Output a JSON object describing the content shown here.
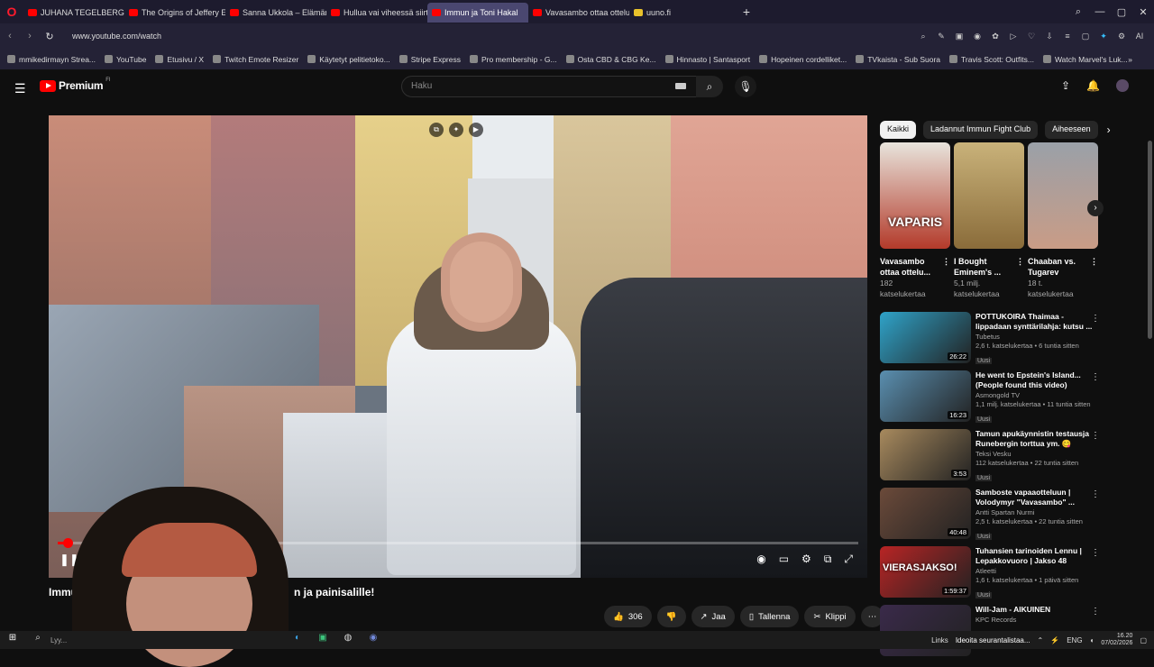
{
  "browser": {
    "tabs": [
      {
        "label": "JUHANA TEGELBERG AAS",
        "fav": "youtube"
      },
      {
        "label": "The Origins of Jeffery Epst",
        "fav": "youtube"
      },
      {
        "label": "Sanna Ukkola – Elämäntap",
        "fav": "youtube"
      },
      {
        "label": "Hullua vai viheessä siirtym",
        "fav": "youtube"
      },
      {
        "label": "Immun ja Toni Hakal",
        "fav": "youtube",
        "active": true
      },
      {
        "label": "Vavasambo ottaa ottelun",
        "fav": "youtube"
      },
      {
        "label": "uuno.fi",
        "fav": "yellow"
      }
    ],
    "url": "www.youtube.com/watch",
    "bookmarks": [
      "mmikedirmayn Strea...",
      "YouTube",
      "Etusivu / X",
      "Twitch Emote Resizer",
      "Käytetyt pelitietoko...",
      "Stripe Express",
      "Pro membership - G...",
      "Osta CBD & CBG Ke...",
      "Hinnasto | Santasport",
      "Hopeinen cordelliket...",
      "TVkaista - Sub Suora",
      "Travis Scott: Outfits...",
      "Watch Marvel's Luk..."
    ]
  },
  "youtube": {
    "logo_text": "Premium",
    "logo_region": "FI",
    "search_placeholder": "Haku",
    "video_title_left": "Immu",
    "video_title_right": "n ja painisalille!",
    "actions": {
      "likes": "306",
      "share": "Jaa",
      "save": "Tallenna",
      "clip": "Klippi"
    },
    "chips": [
      "Kaikki",
      "Ladannut Immun Fight Club",
      "Aiheeseen"
    ],
    "shorts": [
      {
        "title": "Vavasambo ottaa ottelu...",
        "views": "182",
        "views2": "katselukertaa",
        "overlay": "VAPARIS",
        "color1": "#e8e4dc",
        "color2": "#b33a2a"
      },
      {
        "title": "I Bought Eminem's ...",
        "views": "5,1 milj.",
        "views2": "katselukertaa",
        "overlay": "",
        "color1": "#c9b27a",
        "color2": "#8a6c3a"
      },
      {
        "title": "Chaaban vs. Tugarev",
        "views": "18 t.",
        "views2": "katselukertaa",
        "overlay": "",
        "color1": "#9aa0a8",
        "color2": "#c99c86"
      }
    ],
    "videos": [
      {
        "title": "POTTUKOIRA Thaimaa - lippadaan synttärilahja: kutsu ...",
        "channel": "Tubetus",
        "meta": "2,6 t. katselukertaa • 6 tuntia sitten",
        "badge": "Uusi",
        "duration": "26:22",
        "color": "#2fa3c9"
      },
      {
        "title": "He went to Epstein's Island... (People found this video)",
        "channel": "Asmongold TV",
        "meta": "1,1 milj. katselukertaa • 11 tuntia sitten",
        "badge": "Uusi",
        "duration": "16:23",
        "color": "#5a8fb0"
      },
      {
        "title": "Tamun apukäynnistin testausja Runebergin torttua ym. 😋",
        "channel": "Teksi Vesku",
        "meta": "112 katselukertaa • 22 tuntia sitten",
        "badge": "Uusi",
        "duration": "3:53",
        "color": "#a88a5e"
      },
      {
        "title": "Samboste vapaaotteluun | Volodymyr \"Vavasambo\" ...",
        "channel": "Antti Spartan Nurmi",
        "meta": "2,5 t. katselukertaa • 22 tuntia sitten",
        "badge": "Uusi",
        "duration": "40:48",
        "color": "#6b4a3a"
      },
      {
        "title": "Tuhansien tarinoiden Lennu | Lepakkovuoro | Jakso 48",
        "channel": "Atleetti",
        "meta": "1,6 t. katselukertaa • 1 päivä sitten",
        "badge": "Uusi",
        "duration": "1:59:37",
        "color": "#b82424",
        "overlay": "VIERASJAKSO!"
      },
      {
        "title": "Will-Jam - AIKUINEN",
        "channel": "KPC Records",
        "meta": "",
        "badge": "",
        "duration": "",
        "color": "#3a2a4a"
      }
    ]
  },
  "taskbar": {
    "search": "Lyy...",
    "links_label": "Links",
    "notification": "Ideoita seurantalistaa...",
    "lang": "ENG",
    "time": "16.20",
    "date": "07/02/2026"
  }
}
